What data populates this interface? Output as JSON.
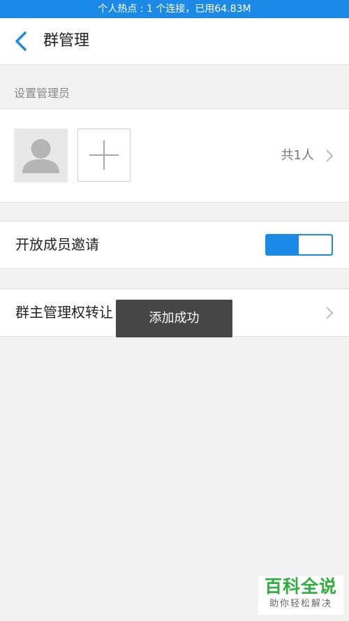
{
  "status_bar": {
    "text": "个人热点 : 1 个连接，已用64.83M"
  },
  "header": {
    "title": "群管理"
  },
  "admin_section": {
    "label": "设置管理员",
    "member_count": "共1人"
  },
  "invite_row": {
    "label": "开放成员邀请",
    "toggle_on": true
  },
  "transfer_row": {
    "label": "群主管理权转让"
  },
  "toast": {
    "text": "添加成功"
  },
  "watermark": {
    "title": "百科全说",
    "subtitle": "助你轻松解决"
  },
  "colors": {
    "accent": "#1b8ae6",
    "watermark_green": "#2eae3d"
  }
}
